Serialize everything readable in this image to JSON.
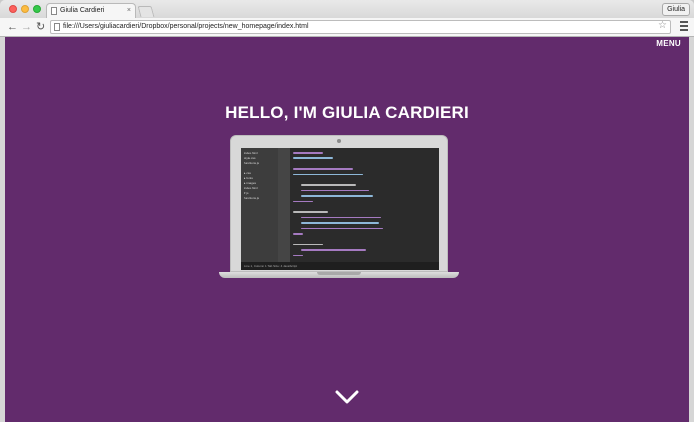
{
  "browser": {
    "tab_title": "Giulia Cardieri",
    "tab_close": "×",
    "profile_button": "Giulia",
    "url": "file:///Users/giuliacardieri/Dropbox/personal/projects/new_homepage/index.html",
    "icons": {
      "back": "back-arrow-icon",
      "forward": "forward-arrow-icon",
      "reload": "reload-icon",
      "star": "bookmark-star-icon",
      "menu": "hamburger-menu-icon",
      "file": "page-icon"
    }
  },
  "page": {
    "menu_label": "MENU",
    "hero_title": "HELLO, I'M GIULIA CARDIERI",
    "background_color": "#622b6c",
    "scroll_icon": "chevron-down-icon"
  },
  "laptop_screen": {
    "sidebar_files": [
      "index.html",
      "style.css",
      "functions.js",
      "",
      "▸ css",
      "▸ fonts",
      "▸ images",
      "index.html",
      "▾ js",
      "functions.js"
    ],
    "status_text": "Line 1, Column 1   Tab Size: 4   JavaScript"
  }
}
